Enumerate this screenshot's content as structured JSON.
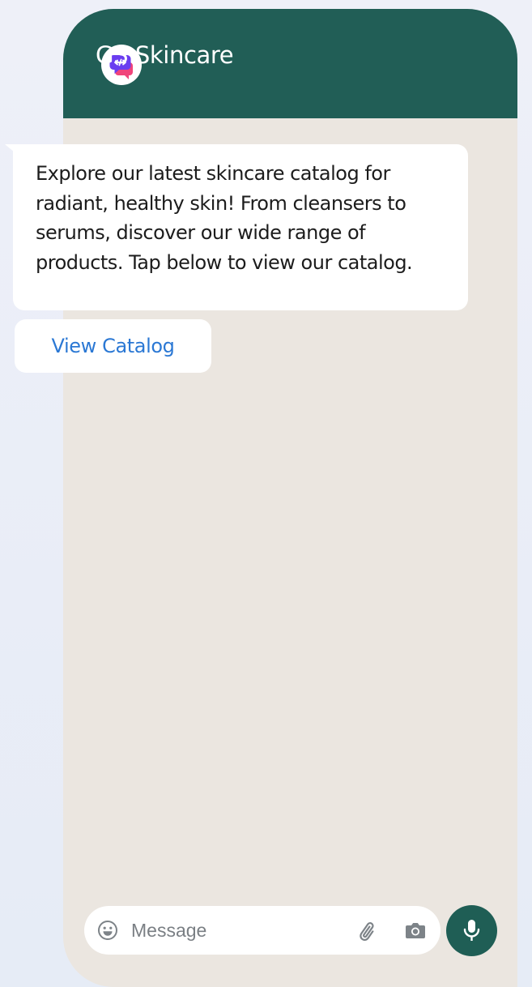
{
  "chat": {
    "contact_name": "GS Skincare",
    "avatar_icon": "code-chat-bubble-icon",
    "header_color": "#215e56"
  },
  "message": {
    "text": "Explore our latest skincare catalog for radiant, healthy skin! From cleansers to serums, discover our wide range of products. Tap below to view our catalog."
  },
  "quick_reply": {
    "label": "View Catalog",
    "color": "#2b78d4"
  },
  "composer": {
    "placeholder": "Message",
    "emoji_icon": "emoji-icon",
    "attach_icon": "paperclip-icon",
    "camera_icon": "camera-icon",
    "mic_icon": "microphone-icon"
  }
}
